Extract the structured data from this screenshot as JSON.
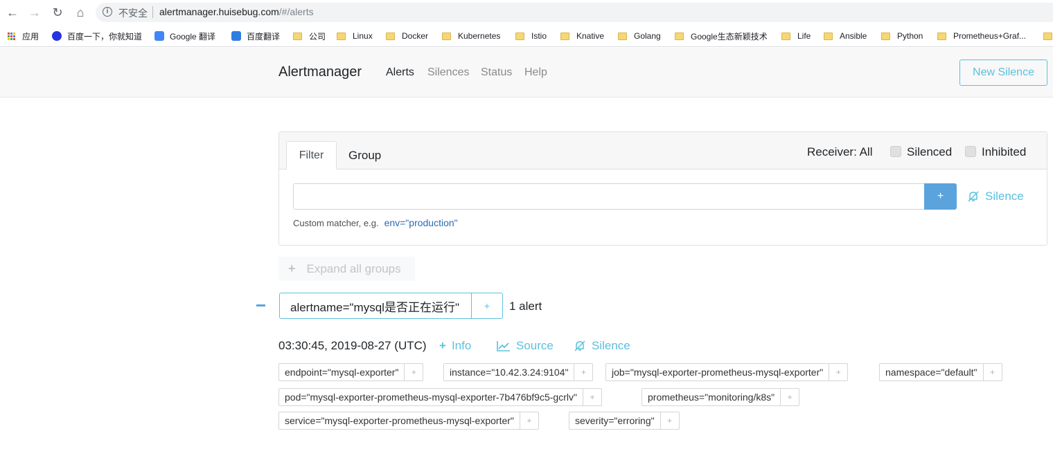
{
  "browser": {
    "insecure_label": "不安全",
    "url_host": "alertmanager.huisebug.com",
    "url_path": "/#/alerts",
    "bookmarks": [
      "应用",
      "百度一下，你就知道",
      "Google 翻译",
      "百度翻译",
      "公司",
      "Linux",
      "Docker",
      "Kubernetes",
      "Istio",
      "Knative",
      "Golang",
      "Google生态新颖技术",
      "Life",
      "Ansible",
      "Python",
      "Prometheus+Graf..."
    ]
  },
  "header": {
    "brand": "Alertmanager",
    "nav": [
      "Alerts",
      "Silences",
      "Status",
      "Help"
    ],
    "new_silence": "New Silence"
  },
  "filter": {
    "tab_filter": "Filter",
    "tab_group": "Group",
    "receiver": "Receiver: All",
    "silenced": "Silenced",
    "inhibited": "Inhibited",
    "input_value": "",
    "plus": "+",
    "silence": "Silence",
    "hint": "Custom matcher, e.g.",
    "hint_example": "env=\"production\""
  },
  "expand_all": "Expand all groups",
  "group": {
    "name": "alertname=\"mysql是否正在运行\"",
    "plus": "+",
    "count": "1 alert"
  },
  "alert": {
    "timestamp": "03:30:45, 2019-08-27 (UTC)",
    "info": "Info",
    "source": "Source",
    "silence": "Silence",
    "labels": [
      "endpoint=\"mysql-exporter\"",
      "instance=\"10.42.3.24:9104\"",
      "job=\"mysql-exporter-prometheus-mysql-exporter\"",
      "namespace=\"default\"",
      "pod=\"mysql-exporter-prometheus-mysql-exporter-7b476bf9c5-gcrlv\"",
      "prometheus=\"monitoring/k8s\"",
      "service=\"mysql-exporter-prometheus-mysql-exporter\"",
      "severity=\"erroring\""
    ],
    "label_plus": "+"
  },
  "colors": {
    "accent": "#5bc0de",
    "primary": "#5ba3dc"
  }
}
